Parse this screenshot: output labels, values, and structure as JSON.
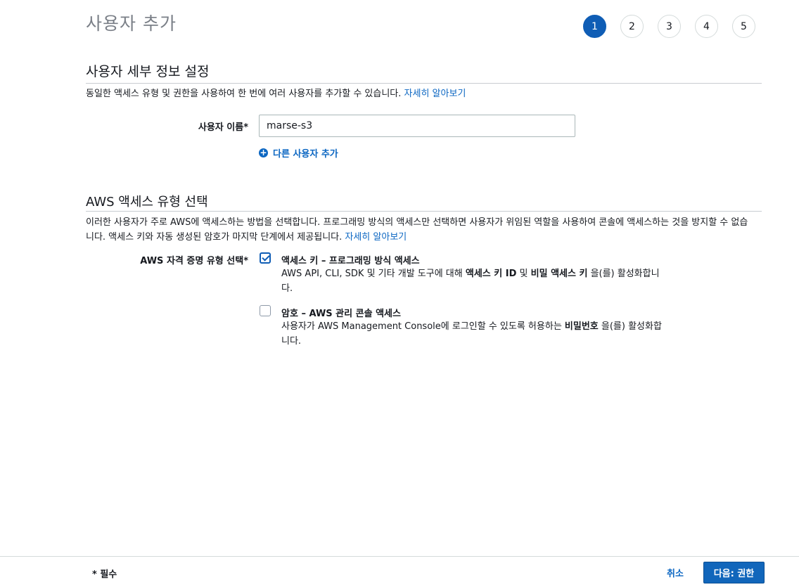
{
  "page": {
    "title": "사용자 추가"
  },
  "steps": [
    {
      "label": "1",
      "active": true
    },
    {
      "label": "2",
      "active": false
    },
    {
      "label": "3",
      "active": false
    },
    {
      "label": "4",
      "active": false
    },
    {
      "label": "5",
      "active": false
    }
  ],
  "user_details": {
    "title": "사용자 세부 정보 설정",
    "description": "동일한 액세스 유형 및 권한을 사용하여 한 번에 여러 사용자를 추가할 수 있습니다.",
    "learn_more": "자세히 알아보기",
    "username_label": "사용자 이름*",
    "username_value": "marse-s3",
    "add_another_user": "다른 사용자 추가"
  },
  "access_type": {
    "title": "AWS 액세스 유형 선택",
    "description_line1": "이러한 사용자가 주로 AWS에 액세스하는 방법을 선택합니다. 프로그래밍 방식의 액세스만 선택하면 사용자가 위임된 역할을 사용하여 콘솔에 액세스하는 것을 방지할 수 없습",
    "description_line2": "니다. 액세스 키와 자동 생성된 암호가 마지막 단계에서 제공됩니다.",
    "learn_more": "자세히 알아보기",
    "credential_label": "AWS 자격 증명 유형 선택*",
    "options": [
      {
        "title": "액세스 키 – 프로그래밍 방식 액세스",
        "checked": true,
        "desc_pre": "AWS API, CLI, SDK 및 기타 개발 도구에 대해 ",
        "desc_bold1": "액세스 키 ID",
        "desc_mid": " 및 ",
        "desc_bold2": "비밀 액세스 키",
        "desc_post": " 을(를) 활성화합니다."
      },
      {
        "title": "암호 – AWS 관리 콘솔 액세스",
        "checked": false,
        "desc_pre": "사용자가 AWS Management Console에 로그인할 수 있도록 허용하는 ",
        "desc_bold1": "비밀번호",
        "desc_post": " 을(를) 활성화합니다."
      }
    ]
  },
  "footer": {
    "required_note": "* 필수",
    "cancel_label": "취소",
    "next_label": "다음: 권한"
  }
}
